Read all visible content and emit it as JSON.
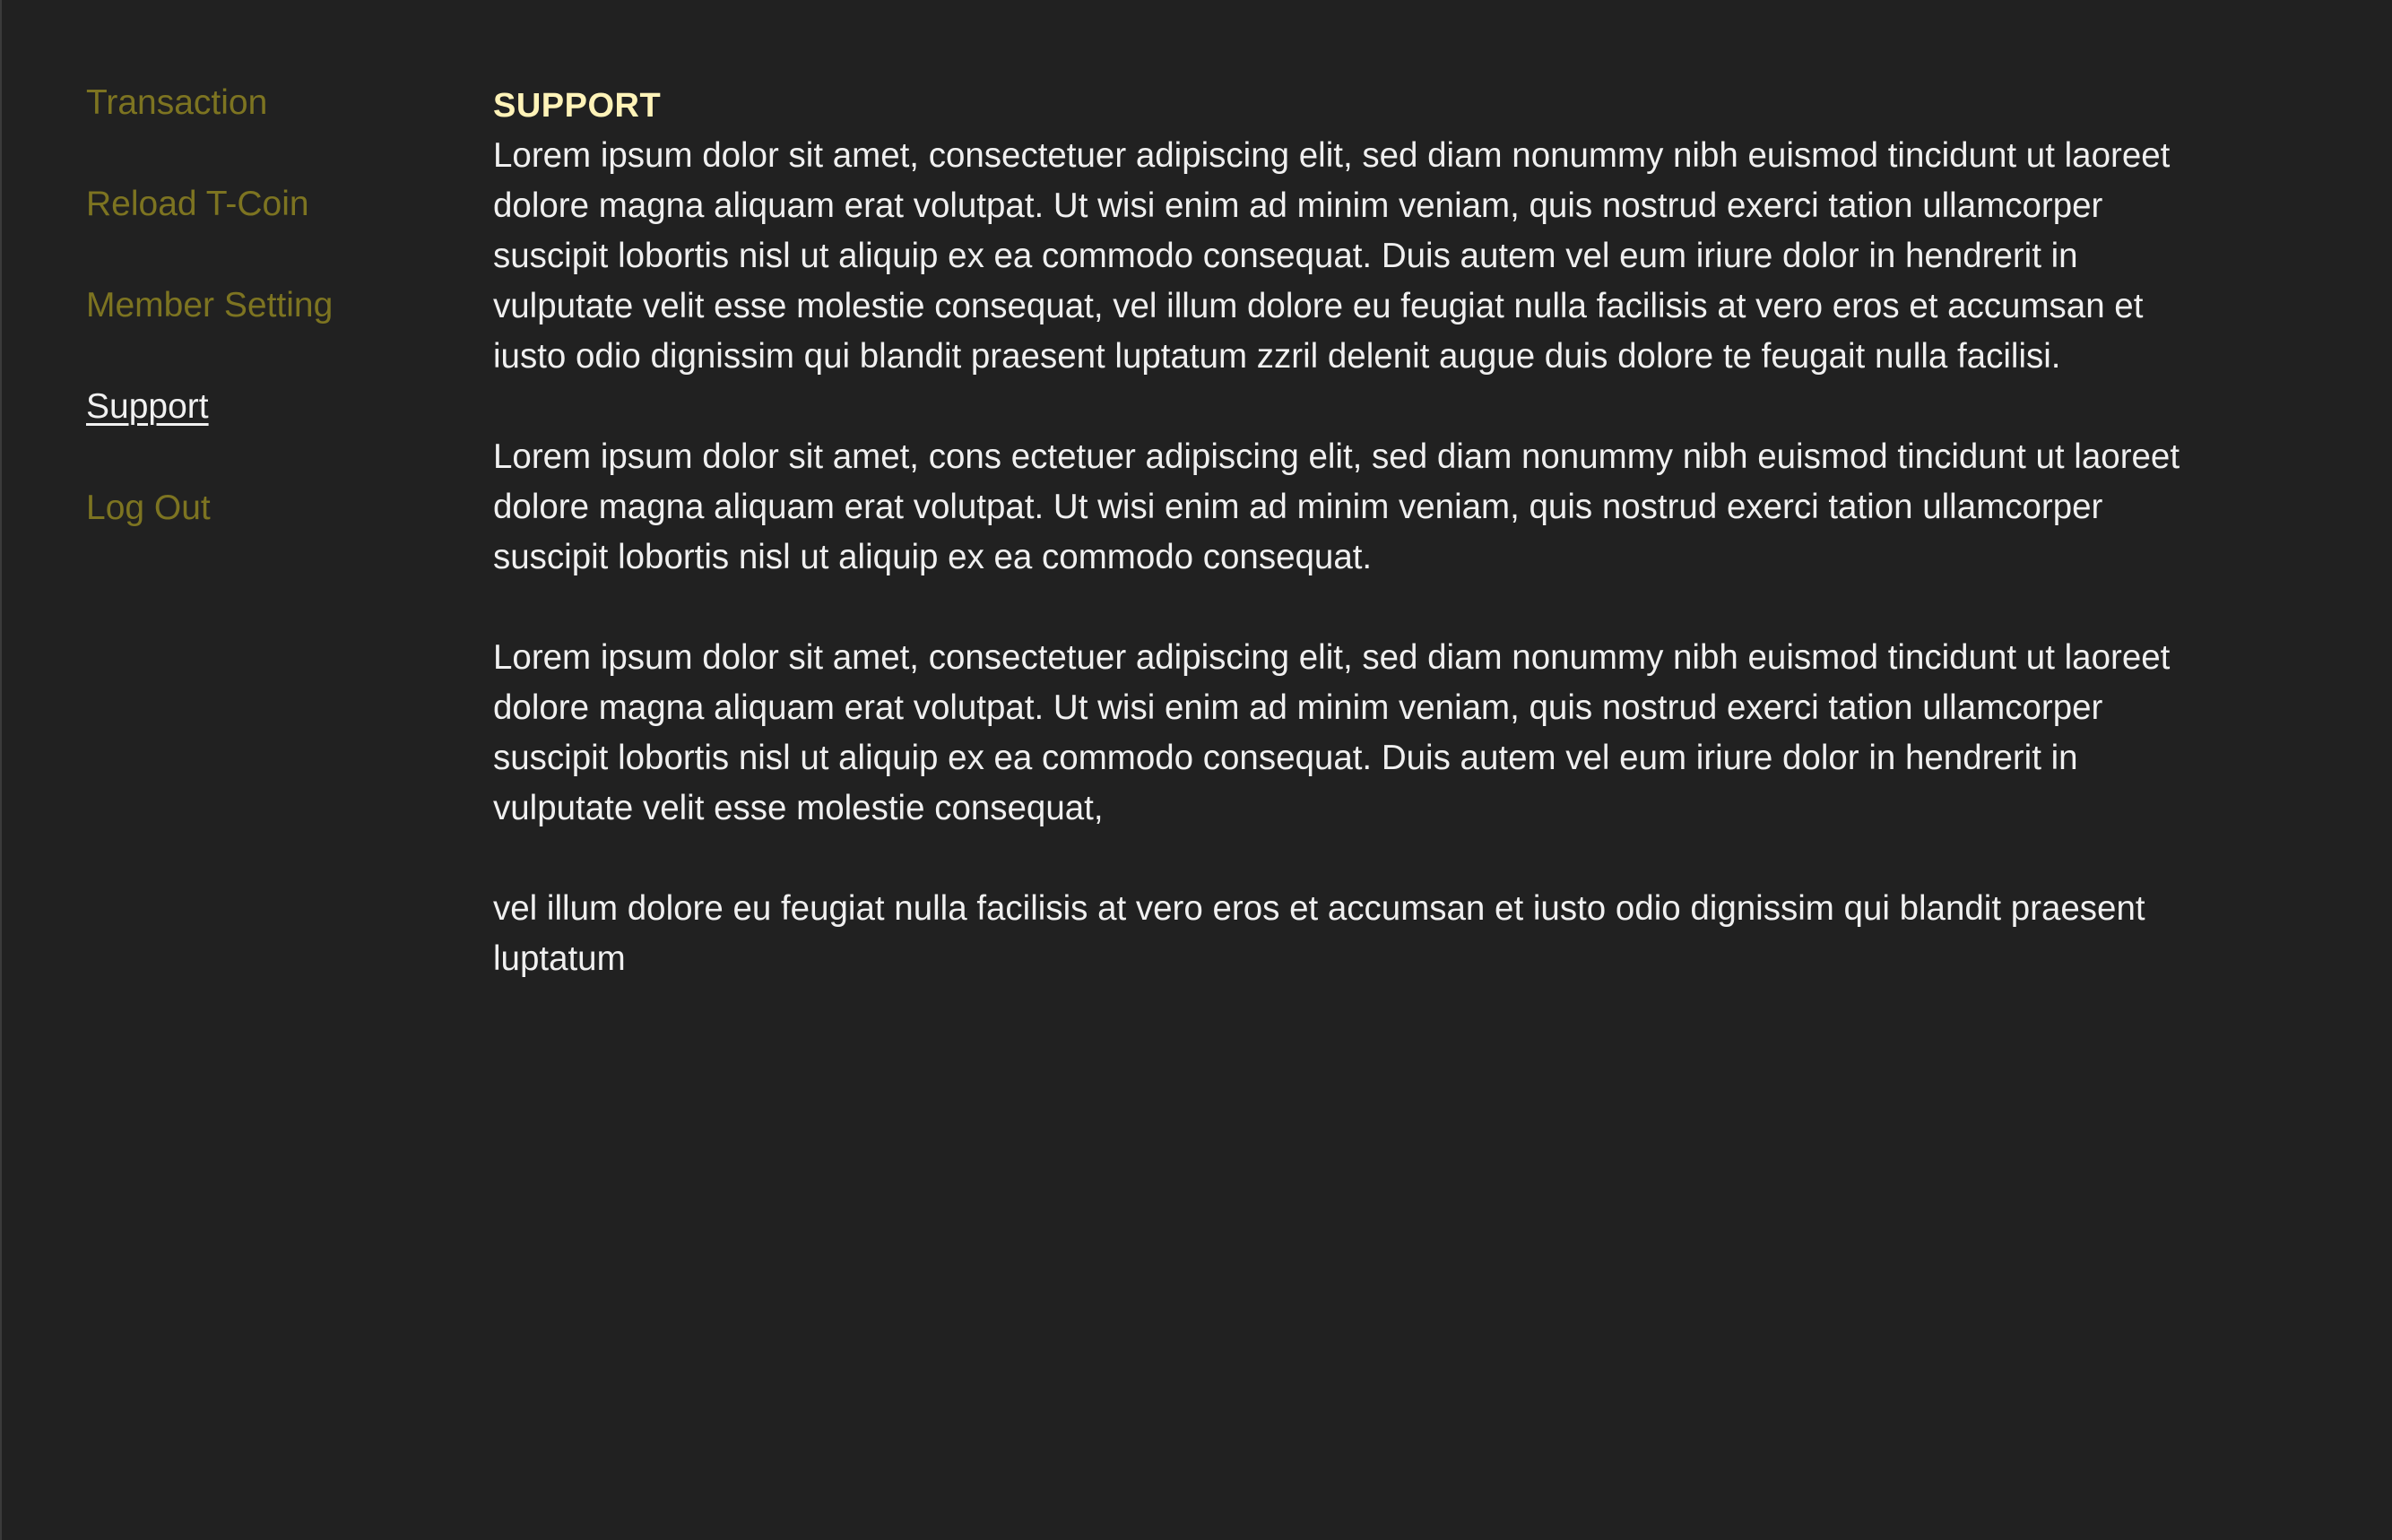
{
  "sidebar": {
    "items": [
      {
        "label": "Transaction",
        "active": false
      },
      {
        "label": "Reload T-Coin",
        "active": false
      },
      {
        "label": "Member Setting",
        "active": false
      },
      {
        "label": "Support",
        "active": true
      },
      {
        "label": "Log Out",
        "active": false
      }
    ]
  },
  "main": {
    "title": "SUPPORT",
    "paragraphs": [
      "Lorem ipsum dolor sit amet, consectetuer adipiscing elit, sed diam nonummy nibh euismod tincidunt ut laoreet dolore magna aliquam erat volutpat. Ut wisi enim ad minim veniam, quis nostrud exerci tation ullamcorper suscipit lobortis nisl ut aliquip ex ea commodo consequat. Duis autem vel eum iriure dolor in hendrerit in vulputate velit esse molestie consequat, vel illum dolore eu feugiat nulla facilisis at vero eros et accumsan et iusto odio dignissim qui blandit praesent luptatum zzril delenit augue duis dolore te feugait nulla facilisi.",
      "Lorem ipsum dolor sit amet, cons ectetuer adipiscing elit, sed diam nonummy nibh euismod tincidunt ut laoreet dolore magna aliquam erat volutpat. Ut wisi enim ad minim veniam, quis nostrud exerci tation ullamcorper suscipit lobortis nisl ut aliquip ex ea commodo consequat.",
      "Lorem ipsum dolor sit amet, consectetuer adipiscing elit, sed diam nonummy nibh euismod tincidunt ut laoreet dolore magna aliquam erat volutpat. Ut wisi enim ad minim veniam, quis nostrud exerci tation ullamcorper suscipit lobortis nisl ut aliquip ex ea commodo consequat. Duis autem vel eum iriure dolor in hendrerit in vulputate velit esse molestie consequat,",
      "vel illum dolore eu feugiat nulla facilisis at vero eros et accumsan et iusto odio dignissim qui blandit praesent luptatum"
    ]
  },
  "colors": {
    "background": "#212121",
    "nav_inactive": "#7d7421",
    "nav_active": "#f1f1f1",
    "title": "#fff3b8",
    "body_text": "#f0f0f0"
  }
}
